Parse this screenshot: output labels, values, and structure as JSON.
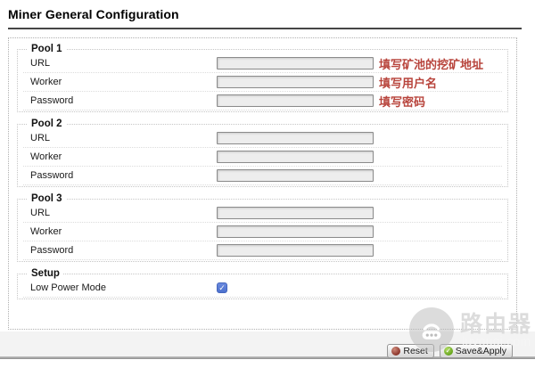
{
  "page": {
    "title": "Miner General Configuration"
  },
  "pools": [
    {
      "legend": "Pool 1",
      "fields": [
        {
          "label": "URL",
          "value": "",
          "annotation": "填写矿池的挖矿地址"
        },
        {
          "label": "Worker",
          "value": "",
          "annotation": "填写用户名"
        },
        {
          "label": "Password",
          "value": "",
          "annotation": "填写密码"
        }
      ]
    },
    {
      "legend": "Pool 2",
      "fields": [
        {
          "label": "URL",
          "value": ""
        },
        {
          "label": "Worker",
          "value": ""
        },
        {
          "label": "Password",
          "value": ""
        }
      ]
    },
    {
      "legend": "Pool 3",
      "fields": [
        {
          "label": "URL",
          "value": ""
        },
        {
          "label": "Worker",
          "value": ""
        },
        {
          "label": "Password",
          "value": ""
        }
      ]
    }
  ],
  "setup": {
    "legend": "Setup",
    "low_power_label": "Low Power Mode",
    "low_power_checked": true
  },
  "footer": {
    "reset_label": "Reset",
    "save_label": "Save&Apply"
  },
  "watermark": {
    "brand": "路由器",
    "domain": "luyouqi.com"
  },
  "icons": {
    "checkmark": "✓",
    "reset_icon": "red-sphere",
    "save_icon": "green-check-circle",
    "router_icon": "router-with-wifi"
  },
  "colors": {
    "annotation_red": "#b8443c",
    "checkbox_blue": "#4c71cf",
    "reset_icon_red": "#8b342a",
    "save_icon_green": "#67a51d",
    "title_rule_gray": "#454545"
  }
}
